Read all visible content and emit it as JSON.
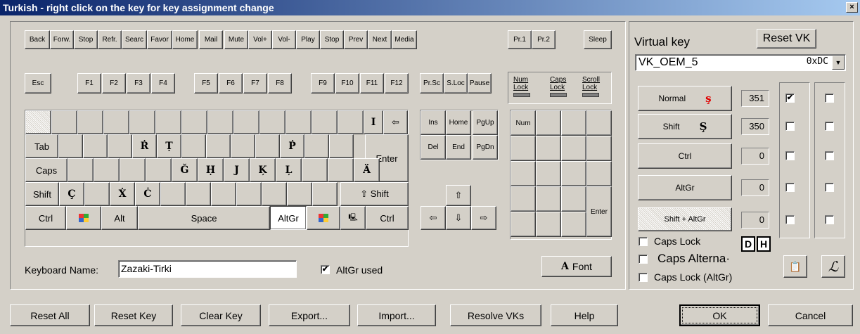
{
  "window": {
    "title": "Turkish - right click on the key for key assignment change",
    "close": "×"
  },
  "media_row": [
    "Back",
    "Forw.",
    "Stop",
    "Refr.",
    "Searc",
    "Favor",
    "Home",
    "Mail",
    "Mute",
    "Vol+",
    "Vol-",
    "Play",
    "Stop",
    "Prev",
    "Next",
    "Media",
    "Pr.1",
    "Pr.2",
    "Sleep"
  ],
  "fn_row": [
    "Esc",
    "F1",
    "F2",
    "F3",
    "F4",
    "F5",
    "F6",
    "F7",
    "F8",
    "F9",
    "F10",
    "F11",
    "F12",
    "Pr.Sc",
    "S.Loc",
    "Pause"
  ],
  "locks": {
    "num": "Num Lock",
    "caps": "Caps Lock",
    "scroll": "Scroll Lock"
  },
  "keys": {
    "i": "I",
    "backspace": "⇦",
    "tab": "Tab",
    "r": "Ṙ",
    "t": "Ṭ",
    "p": "Ṗ",
    "enter": "Enter",
    "caps": "Caps",
    "g": "Ğ",
    "h": "Ḥ",
    "j": "J",
    "k": "Ķ",
    "l": "Ļ",
    "a": "Ä",
    "shift": "Shift",
    "c_cedil": "Ç",
    "x": "Ẋ",
    "c_dot": "Ċ",
    "rshift": "⇧ Shift",
    "ctrl": "Ctrl",
    "alt": "Alt",
    "space": "Space",
    "altgr": "AltGr",
    "rctrl": "Ctrl",
    "win_icon": "windows-icon",
    "menu_icon": "menu-icon"
  },
  "nav": {
    "ins": "Ins",
    "home": "Home",
    "pgup": "PgUp",
    "del": "Del",
    "end": "End",
    "pgdn": "PgDn",
    "up": "⇧",
    "left": "⇦",
    "down": "⇩",
    "right": "⇨"
  },
  "numpad": {
    "num": "Num",
    "enter": "Enter"
  },
  "keyboard_name": {
    "label": "Keyboard Name:",
    "value": "Zazaki-Tirki"
  },
  "altgr_used": {
    "label": "AltGr used",
    "checked": true
  },
  "font_button": {
    "icon": "A",
    "label": "Font"
  },
  "right_panel": {
    "virtual_key_label": "Virtual key",
    "reset_vk": "Reset VK",
    "vk_name": "VK_OEM_5",
    "vk_code": "0xDC",
    "rows": [
      {
        "label": "Normal",
        "char": "ş",
        "value": "351",
        "check1": true,
        "check2": false
      },
      {
        "label": "Shift",
        "char": "Ş",
        "value": "350",
        "check1": false,
        "check2": false
      },
      {
        "label": "Ctrl",
        "char": "",
        "value": "0",
        "check1": false,
        "check2": false
      },
      {
        "label": "AltGr",
        "char": "",
        "value": "0",
        "check1": false,
        "check2": false
      },
      {
        "label": "Shift + AltGr",
        "char": "",
        "value": "0",
        "check1": false,
        "check2": false
      }
    ],
    "caps_lock": "Caps Lock",
    "d": "D",
    "h": "H",
    "caps_alternate": "Caps Alterna·",
    "caps_lock_altgr": "Caps Lock (AltGr)",
    "icon1": "properties-icon",
    "icon2": "pen-icon"
  },
  "bottom_buttons": [
    "Reset All",
    "Reset Key",
    "Clear Key",
    "Export...",
    "Import...",
    "Resolve VKs",
    "Help"
  ],
  "ok": "OK",
  "cancel": "Cancel",
  "colors": {
    "title_start": "#0a246a",
    "title_end": "#a6caf0",
    "face": "#d4d0c8",
    "red": "#e00000"
  }
}
